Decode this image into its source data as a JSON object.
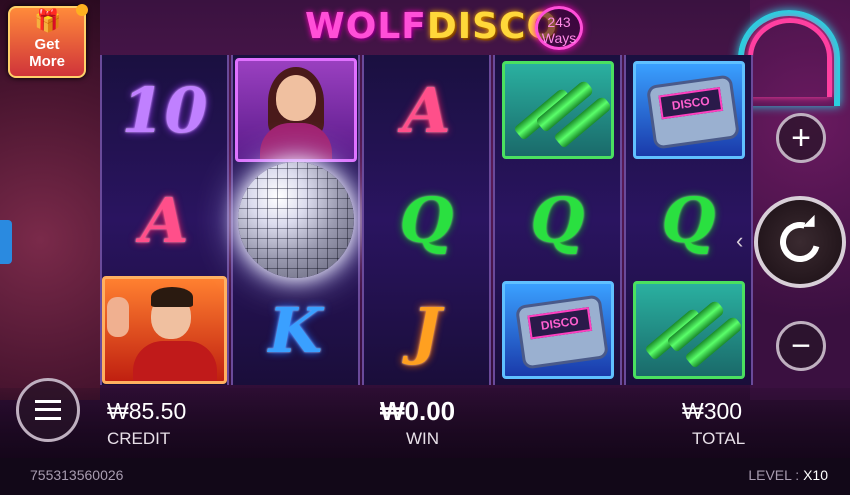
{
  "game": {
    "logo_wolf": "WOLF",
    "logo_disco": "DISCO",
    "ways_number": "243",
    "ways_label": "Ways"
  },
  "promo": {
    "get_label": "Get",
    "more_label": "More"
  },
  "reels": [
    [
      "10",
      "A",
      "man-symbol"
    ],
    [
      "woman-symbol",
      "disco-ball",
      "K"
    ],
    [
      "A",
      "Q",
      "J"
    ],
    [
      "bottles-symbol",
      "Q",
      "pager-symbol"
    ],
    [
      "pager-symbol",
      "Q",
      "bottles-symbol"
    ]
  ],
  "pager_text": "DISCO",
  "controls": {
    "plus": "+",
    "minus": "−"
  },
  "stats": {
    "credit_value": "₩85.50",
    "credit_label": "CREDIT",
    "win_value": "₩0.00",
    "win_label": "WIN",
    "total_value": "₩300",
    "total_label": "TOTAL"
  },
  "footer": {
    "session_id": "755313560026",
    "level_label": "LEVEL : ",
    "level_value": "X10"
  }
}
